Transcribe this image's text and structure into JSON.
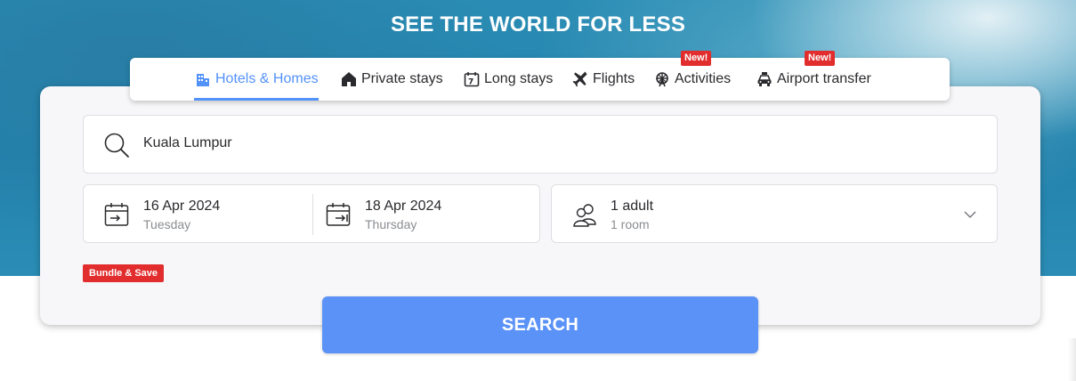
{
  "hero": {
    "title": "SEE THE WORLD FOR LESS"
  },
  "tabs": [
    {
      "label": "Hotels & Homes",
      "icon": "hotel-icon",
      "active": true
    },
    {
      "label": "Private stays",
      "icon": "home-icon"
    },
    {
      "label": "Long stays",
      "icon": "calendar-7-icon"
    },
    {
      "label": "Flights",
      "icon": "airplane-icon"
    },
    {
      "label": "Activities",
      "icon": "ferris-wheel-icon",
      "badge": "New!"
    },
    {
      "label": "Airport transfer",
      "icon": "car-icon",
      "badge": "New!"
    }
  ],
  "search": {
    "value": "Kuala Lumpur",
    "icon": "search-icon"
  },
  "dates": {
    "check_in": {
      "date": "16 Apr 2024",
      "day": "Tuesday"
    },
    "check_out": {
      "date": "18 Apr 2024",
      "day": "Thursday"
    }
  },
  "guests": {
    "adults": "1 adult",
    "rooms": "1 room"
  },
  "bundle_label": "Bundle & Save",
  "search_button": "SEARCH",
  "colors": {
    "accent": "#5392f9",
    "button": "#5a92f7",
    "badge": "#e12d2d",
    "hero": "#2a8cb4"
  }
}
